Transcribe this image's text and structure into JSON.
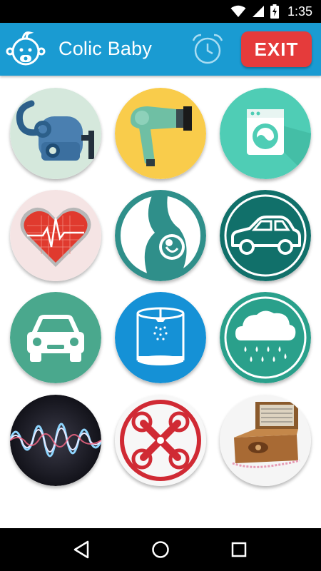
{
  "status_bar": {
    "time": "1:35",
    "icons": [
      "wifi-icon",
      "cell-signal-icon",
      "battery-charging-icon"
    ]
  },
  "app_bar": {
    "title": "Colic Baby",
    "logo_icon": "baby-face-icon",
    "alarm_icon": "alarm-clock-icon",
    "exit_label": "EXIT",
    "colors": {
      "bar": "#1a9bd2",
      "exit": "#e53b3b"
    }
  },
  "sounds": [
    {
      "id": "vacuum-cleaner",
      "icon": "vacuum-cleaner-icon",
      "bg": "#d5e8dc"
    },
    {
      "id": "hair-dryer",
      "icon": "hair-dryer-icon",
      "bg": "#f9cc4b"
    },
    {
      "id": "washing-machine",
      "icon": "washing-machine-icon",
      "bg": "#4fcdb5"
    },
    {
      "id": "heartbeat",
      "icon": "heart-monitor-icon",
      "bg": "#f5e4e4"
    },
    {
      "id": "womb",
      "icon": "pregnant-belly-icon",
      "bg": "#2f8f8a"
    },
    {
      "id": "car-ride",
      "icon": "car-side-icon",
      "bg": "#11706a"
    },
    {
      "id": "car-engine",
      "icon": "car-front-icon",
      "bg": "#4aa88d"
    },
    {
      "id": "shower",
      "icon": "shower-cabin-icon",
      "bg": "#1591d6"
    },
    {
      "id": "rain",
      "icon": "rain-cloud-icon",
      "bg": "#2aa08b"
    },
    {
      "id": "white-noise",
      "icon": "sound-wave-icon",
      "bg": "#1a1a22"
    },
    {
      "id": "drone",
      "icon": "drone-icon",
      "bg": "#f7f7f7"
    },
    {
      "id": "music-box",
      "icon": "music-box-icon",
      "bg": "#f5f5f5"
    }
  ],
  "nav_bar": {
    "icons": [
      "back-icon",
      "home-icon",
      "recents-icon"
    ]
  }
}
